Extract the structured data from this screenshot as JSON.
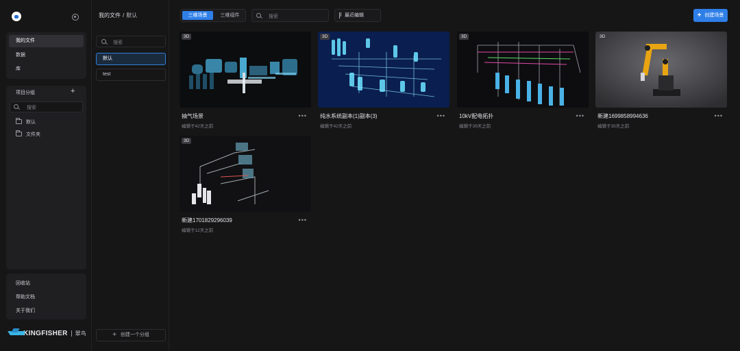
{
  "sidebar": {
    "nav": [
      {
        "label": "我的文件",
        "active": true
      },
      {
        "label": "数据",
        "active": false
      },
      {
        "label": "库",
        "active": false
      }
    ],
    "groups_title": "项目分组",
    "groups_search_placeholder": "搜索",
    "folders": [
      "默认",
      "文件夹"
    ],
    "bottom": [
      "回收站",
      "帮助文档",
      "关于我们"
    ],
    "brand_name": "KINGFISHER",
    "brand_cn": "翠鸟"
  },
  "group_column": {
    "breadcrumb_root": "我的文件",
    "breadcrumb_sep": "/",
    "breadcrumb_current": "默认",
    "search_placeholder": "搜索",
    "groups": [
      {
        "label": "默认",
        "active": true
      },
      {
        "label": "test",
        "active": false
      }
    ],
    "create_group_label": "创建一个分组"
  },
  "toolbar": {
    "tabs": [
      {
        "label": "三维场景",
        "active": true
      },
      {
        "label": "三维组件",
        "active": false
      }
    ],
    "search_placeholder": "搜索",
    "sort_label": "最近编辑",
    "create_label": "创建场景"
  },
  "cards": [
    {
      "badge": "3D",
      "title": "抽气场景",
      "subtitle": "编辑于42天之前",
      "thumb": "industrial-pumps"
    },
    {
      "badge": "3D",
      "title": "纯水系统副本(1)副本(3)",
      "subtitle": "编辑于42天之前",
      "thumb": "water-system-blue"
    },
    {
      "badge": "3D",
      "title": "10kV配电拓扑",
      "subtitle": "编辑于39天之前",
      "thumb": "distribution-topology"
    },
    {
      "badge": "3D",
      "title": "新建1699858994636",
      "subtitle": "编辑于35天之前",
      "thumb": "robot-arm"
    },
    {
      "badge": "3D",
      "title": "新建1701829296039",
      "subtitle": "编辑于12天之前",
      "thumb": "piping-layout"
    }
  ],
  "colors": {
    "accent": "#2f7fe8",
    "background": "#161617",
    "panel": "#1f1f22"
  }
}
